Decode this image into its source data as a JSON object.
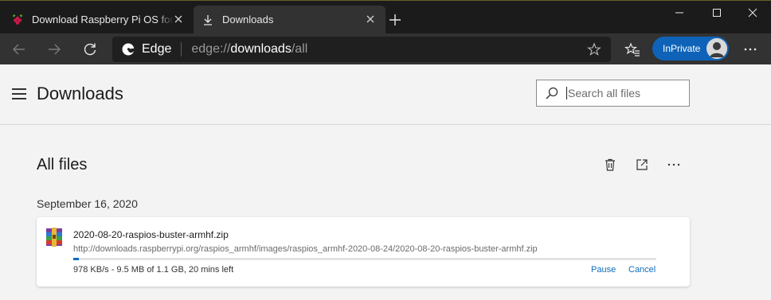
{
  "tabs": [
    {
      "title": "Download Raspberry Pi OS for Raspberry Pi",
      "icon": "raspberry-icon"
    },
    {
      "title": "Downloads",
      "icon": "download-icon"
    }
  ],
  "toolbar": {
    "edge_label": "Edge",
    "url": {
      "scheme": "edge://",
      "host": "downloads",
      "path": "/all"
    },
    "inprivate_label": "InPrivate"
  },
  "page": {
    "title": "Downloads",
    "search_placeholder": "Search all files",
    "section_title": "All files"
  },
  "downloads": [
    {
      "date": "September 16, 2020",
      "file_name": "2020-08-20-raspios-buster-armhf.zip",
      "url": "http://downloads.raspberrypi.org/raspios_armhf/images/raspios_armhf-2020-08-24/2020-08-20-raspios-buster-armhf.zip",
      "status": "978 KB/s - 9.5 MB of 1.1 GB, 20 mins left",
      "progress_fraction": 0.009,
      "actions": {
        "pause": "Pause",
        "cancel": "Cancel"
      }
    }
  ],
  "colors": {
    "accent": "#0f6cbd",
    "inprivate": "#0e63b8"
  }
}
